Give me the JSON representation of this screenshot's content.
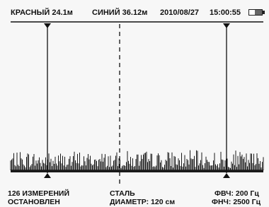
{
  "status": {
    "red_cursor": "КРАСНЫЙ 24.1м",
    "blue_cursor": "СИНИЙ 36.12м",
    "date": "2010/08/27",
    "time": "15:00:55",
    "battery_level": 0.55
  },
  "info": {
    "measurements": "126 ИЗМЕРЕНИЙ",
    "state": "ОСТАНОВЛЕН",
    "material": "СТАЛЬ",
    "diameter": "ДИАМЕТР: 120 см",
    "hpf": "ФВЧ: 200 Гц",
    "lpf": "ФНЧ: 2500 Гц"
  },
  "colors": {
    "trace": "#1a1a1a",
    "cursor": "#111111",
    "background": "#f7f7f7"
  }
}
